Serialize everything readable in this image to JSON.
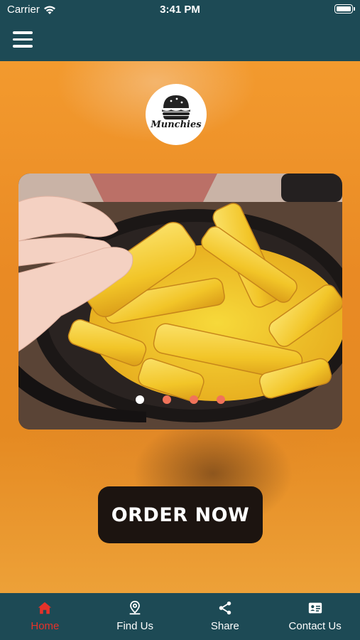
{
  "status_bar": {
    "carrier": "Carrier",
    "time": "3:41 PM"
  },
  "header": {
    "menu_icon": "hamburger-menu-icon"
  },
  "logo": {
    "brand": "Munchies",
    "icon": "burger-icon"
  },
  "carousel": {
    "slide_count": 4,
    "active_index": 0,
    "image_subject": "cheese-fries-in-skillet",
    "colors": {
      "active_dot": "#ffffff",
      "inactive_dot": "#f1735a"
    }
  },
  "cta": {
    "label": "ORDER NOW"
  },
  "tab_bar": {
    "active_color": "#e5322a",
    "items": [
      {
        "label": "Home",
        "icon": "home-icon",
        "active": true
      },
      {
        "label": "Find Us",
        "icon": "location-pin-icon",
        "active": false
      },
      {
        "label": "Share",
        "icon": "share-icon",
        "active": false
      },
      {
        "label": "Contact Us",
        "icon": "contact-card-icon",
        "active": false
      }
    ]
  },
  "theme": {
    "bar_color": "#1d4a55",
    "button_color": "#1c1410"
  }
}
